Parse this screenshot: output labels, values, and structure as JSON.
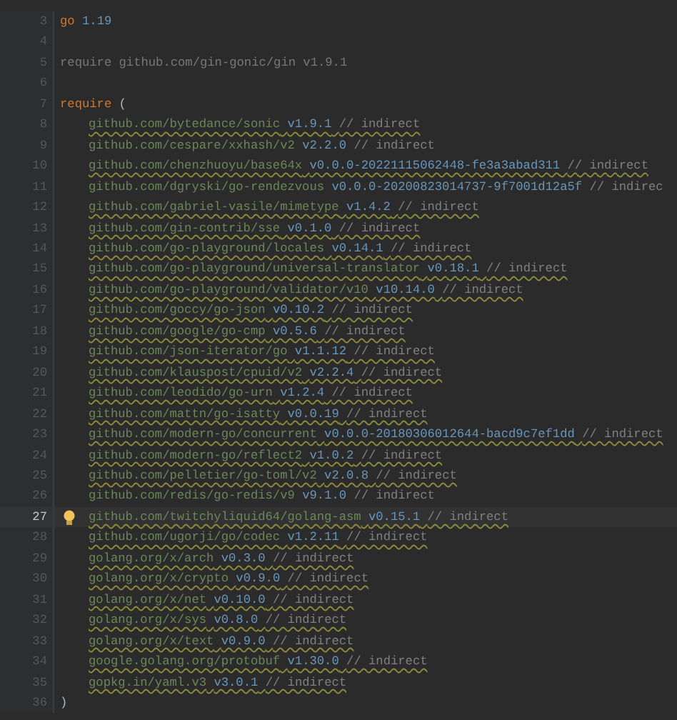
{
  "editor": {
    "lines": [
      {
        "number": "3",
        "kind": "go",
        "keyword": "go",
        "version": "1.19",
        "current": false
      },
      {
        "number": "4",
        "kind": "blank",
        "current": false
      },
      {
        "number": "5",
        "kind": "require_single",
        "text": "require github.com/gin-gonic/gin v1.9.1",
        "current": false
      },
      {
        "number": "6",
        "kind": "blank",
        "current": false
      },
      {
        "number": "7",
        "kind": "require_open",
        "keyword": "require",
        "paren": "(",
        "current": false
      },
      {
        "number": "8",
        "kind": "dep",
        "path": "github.com/bytedance/sonic",
        "version": "v1.9.1",
        "comment": "// indirect",
        "underlined": true,
        "current": false
      },
      {
        "number": "9",
        "kind": "dep",
        "path": "github.com/cespare/xxhash/v2",
        "version": "v2.2.0",
        "comment": "// indirect",
        "underlined": false,
        "current": false
      },
      {
        "number": "10",
        "kind": "dep",
        "path": "github.com/chenzhuoyu/base64x",
        "version": "v0.0.0-20221115062448-fe3a3abad311",
        "comment": "// indirect",
        "underlined": true,
        "current": false
      },
      {
        "number": "11",
        "kind": "dep",
        "path": "github.com/dgryski/go-rendezvous",
        "version": "v0.0.0-20200823014737-9f7001d12a5f",
        "comment": "// indirec",
        "underlined": false,
        "current": false
      },
      {
        "number": "12",
        "kind": "dep",
        "path": "github.com/gabriel-vasile/mimetype",
        "version": "v1.4.2",
        "comment": "// indirect",
        "underlined": true,
        "current": false
      },
      {
        "number": "13",
        "kind": "dep",
        "path": "github.com/gin-contrib/sse",
        "version": "v0.1.0",
        "comment": "// indirect",
        "underlined": true,
        "current": false
      },
      {
        "number": "14",
        "kind": "dep",
        "path": "github.com/go-playground/locales",
        "version": "v0.14.1",
        "comment": "// indirect",
        "underlined": true,
        "current": false
      },
      {
        "number": "15",
        "kind": "dep",
        "path": "github.com/go-playground/universal-translator",
        "version": "v0.18.1",
        "comment": "// indirect",
        "underlined": true,
        "current": false
      },
      {
        "number": "16",
        "kind": "dep",
        "path": "github.com/go-playground/validator/v10",
        "version": "v10.14.0",
        "comment": "// indirect",
        "underlined": true,
        "current": false
      },
      {
        "number": "17",
        "kind": "dep",
        "path": "github.com/goccy/go-json",
        "version": "v0.10.2",
        "comment": "// indirect",
        "underlined": true,
        "current": false
      },
      {
        "number": "18",
        "kind": "dep",
        "path": "github.com/google/go-cmp",
        "version": "v0.5.6",
        "comment": "// indirect",
        "underlined": true,
        "current": false
      },
      {
        "number": "19",
        "kind": "dep",
        "path": "github.com/json-iterator/go",
        "version": "v1.1.12",
        "comment": "// indirect",
        "underlined": true,
        "current": false
      },
      {
        "number": "20",
        "kind": "dep",
        "path": "github.com/klauspost/cpuid/v2",
        "version": "v2.2.4",
        "comment": "// indirect",
        "underlined": true,
        "current": false
      },
      {
        "number": "21",
        "kind": "dep",
        "path": "github.com/leodido/go-urn",
        "version": "v1.2.4",
        "comment": "// indirect",
        "underlined": true,
        "current": false
      },
      {
        "number": "22",
        "kind": "dep",
        "path": "github.com/mattn/go-isatty",
        "version": "v0.0.19",
        "comment": "// indirect",
        "underlined": true,
        "current": false
      },
      {
        "number": "23",
        "kind": "dep",
        "path": "github.com/modern-go/concurrent",
        "version": "v0.0.0-20180306012644-bacd9c7ef1dd",
        "comment": "// indirect",
        "underlined": true,
        "current": false
      },
      {
        "number": "24",
        "kind": "dep",
        "path": "github.com/modern-go/reflect2",
        "version": "v1.0.2",
        "comment": "// indirect",
        "underlined": true,
        "current": false
      },
      {
        "number": "25",
        "kind": "dep",
        "path": "github.com/pelletier/go-toml/v2",
        "version": "v2.0.8",
        "comment": "// indirect",
        "underlined": true,
        "current": false
      },
      {
        "number": "26",
        "kind": "dep",
        "path": "github.com/redis/go-redis/v9",
        "version": "v9.1.0",
        "comment": "// indirect",
        "underlined": false,
        "current": false
      },
      {
        "number": "27",
        "kind": "dep",
        "path": "github.com/twitchyliquid64/golang-asm",
        "version": "v0.15.1",
        "comment": "// indirect",
        "underlined": true,
        "current": true
      },
      {
        "number": "28",
        "kind": "dep",
        "path": "github.com/ugorji/go/codec",
        "version": "v1.2.11",
        "comment": "// indirect",
        "underlined": true,
        "current": false
      },
      {
        "number": "29",
        "kind": "dep",
        "path": "golang.org/x/arch",
        "version": "v0.3.0",
        "comment": "// indirect",
        "underlined": true,
        "current": false
      },
      {
        "number": "30",
        "kind": "dep",
        "path": "golang.org/x/crypto",
        "version": "v0.9.0",
        "comment": "// indirect",
        "underlined": true,
        "current": false
      },
      {
        "number": "31",
        "kind": "dep",
        "path": "golang.org/x/net",
        "version": "v0.10.0",
        "comment": "// indirect",
        "underlined": true,
        "current": false
      },
      {
        "number": "32",
        "kind": "dep",
        "path": "golang.org/x/sys",
        "version": "v0.8.0",
        "comment": "// indirect",
        "underlined": true,
        "current": false
      },
      {
        "number": "33",
        "kind": "dep",
        "path": "golang.org/x/text",
        "version": "v0.9.0",
        "comment": "// indirect",
        "underlined": true,
        "current": false
      },
      {
        "number": "34",
        "kind": "dep",
        "path": "google.golang.org/protobuf",
        "version": "v1.30.0",
        "comment": "// indirect",
        "underlined": true,
        "current": false
      },
      {
        "number": "35",
        "kind": "dep",
        "path": "gopkg.in/yaml.v3",
        "version": "v3.0.1",
        "comment": "// indirect",
        "underlined": true,
        "current": false
      },
      {
        "number": "36",
        "kind": "close",
        "paren": ")",
        "current": false
      }
    ]
  }
}
